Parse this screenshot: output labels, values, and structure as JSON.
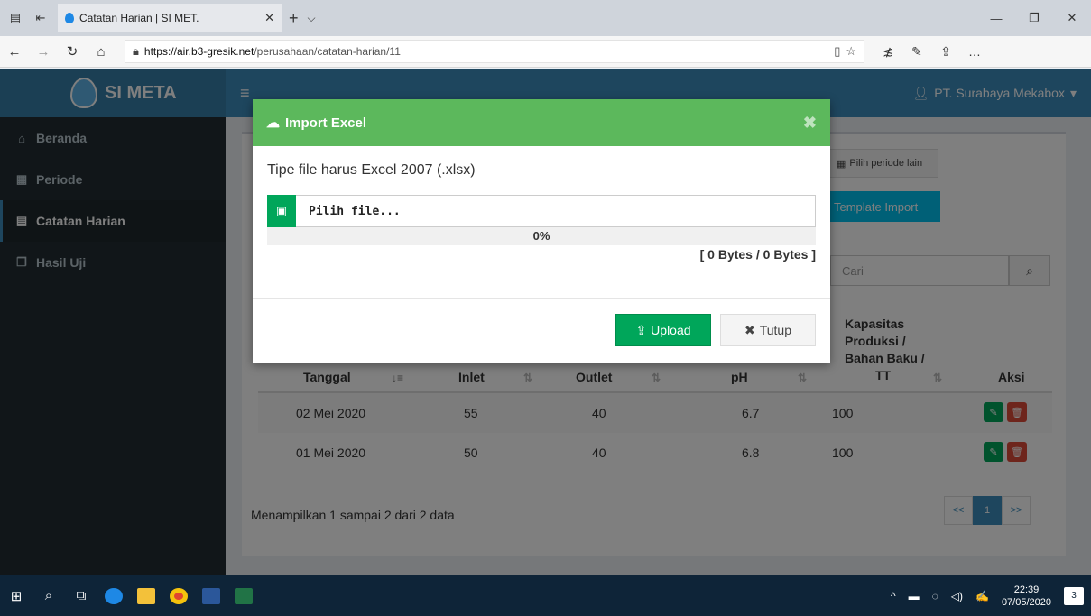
{
  "browser": {
    "tab_title": "Catatan Harian | SI MET.",
    "url_host": "https://air.b3-gresik.net",
    "url_path": "/perusahaan/catatan-harian/11"
  },
  "app": {
    "brand": "SI META",
    "user": "PT. Surabaya Mekabox"
  },
  "sidebar": {
    "items": [
      {
        "label": "Beranda",
        "icon": "home-icon"
      },
      {
        "label": "Periode",
        "icon": "calendar-icon"
      },
      {
        "label": "Catatan Harian",
        "icon": "file-icon",
        "active": true
      },
      {
        "label": "Hasil Uji",
        "icon": "copy-icon"
      }
    ]
  },
  "toolbar": {
    "periode_label": "Pilih periode lain",
    "template_label": "Template Import",
    "search_placeholder": "Cari"
  },
  "table": {
    "headers": {
      "tanggal": "Tanggal",
      "inlet": "Inlet",
      "outlet": "Outlet",
      "ph": "pH",
      "kapasitas_1": "Kapasitas",
      "kapasitas_2": "Produksi /",
      "kapasitas_3": "Bahan Baku /",
      "kapasitas_4": "TT",
      "aksi": "Aksi"
    },
    "rows": [
      {
        "tanggal": "02 Mei 2020",
        "inlet": "55",
        "outlet": "40",
        "ph": "6.7",
        "kapasitas": "100"
      },
      {
        "tanggal": "01 Mei 2020",
        "inlet": "50",
        "outlet": "40",
        "ph": "6.8",
        "kapasitas": "100"
      }
    ],
    "info": "Menampilkan 1 sampai 2 dari 2 data",
    "pager": {
      "prev": "<<",
      "current": "1",
      "next": ">>"
    }
  },
  "modal": {
    "title": "Import Excel",
    "note": "Tipe file harus Excel 2007 (.xlsx)",
    "file_label": "Pilih file...",
    "progress_text": "0%",
    "progress_value": 0,
    "bytes": "[ 0 Bytes / 0 Bytes ]",
    "upload_label": "Upload",
    "close_label": "Tutup"
  },
  "taskbar": {
    "time": "22:39",
    "date": "07/05/2020",
    "notifications": "3"
  },
  "colors": {
    "primary": "#3c8dbc",
    "success": "#00a65a",
    "modal_header": "#5cb85c",
    "danger": "#dd4b39",
    "info": "#00c0ef",
    "sidebar": "#222d32"
  }
}
